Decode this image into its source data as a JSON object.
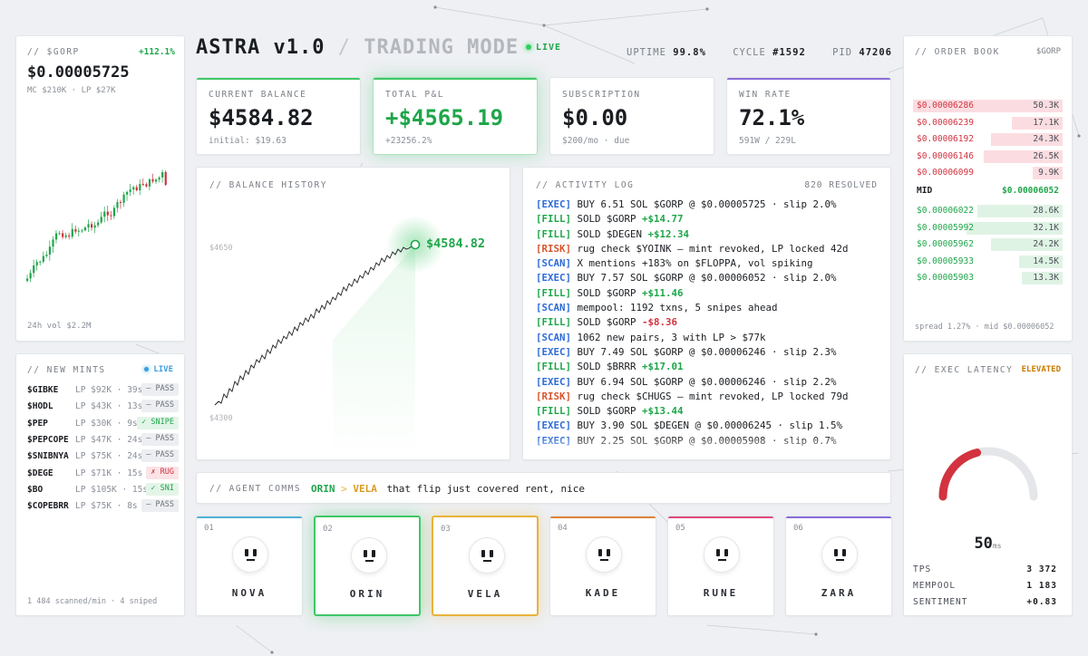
{
  "header": {
    "brand": "ASTRA v1.0",
    "separator": "/",
    "mode": "TRADING MODE",
    "live": "LIVE",
    "uptime_label": "UPTIME",
    "uptime": "99.8%",
    "cycle_label": "CYCLE",
    "cycle": "#1592",
    "pid_label": "PID",
    "pid": "47206"
  },
  "token": {
    "title": "// $GORP",
    "change": "+112.1%",
    "price": "$0.00005725",
    "mc_lp": "MC $210K · LP $27K",
    "vol": "24h vol $2.2M"
  },
  "metrics": [
    {
      "label": "CURRENT BALANCE",
      "value": "$4584.82",
      "sub": "initial: $19.63",
      "accent": "#3fc767"
    },
    {
      "label": "TOTAL P&L",
      "value": "+$4565.19",
      "sub": "+23256.2%",
      "accent": "#3fc767"
    },
    {
      "label": "SUBSCRIPTION",
      "value": "$0.00",
      "sub": "$200/mo · due",
      "accent": "#ffffff"
    },
    {
      "label": "WIN RATE",
      "value": "72.1%",
      "sub": "591W / 229L",
      "accent": "#8a6cd9"
    }
  ],
  "balance_history": {
    "title": "// BALANCE HISTORY",
    "y_high": "$4650",
    "y_low": "$4300",
    "current": "$4584.82"
  },
  "activity": {
    "title": "// ACTIVITY LOG",
    "resolved": "820 RESOLVED",
    "rows": [
      {
        "tag": "[EXEC]",
        "type": "EXEC",
        "text": " BUY 6.51 SOL $GORP @ $0.00005725 · slip 2.0%",
        "pnl": ""
      },
      {
        "tag": "[FILL]",
        "type": "FILL",
        "text": " SOLD $GORP ",
        "pnl": "+$14.77"
      },
      {
        "tag": "[FILL]",
        "type": "FILL",
        "text": " SOLD $DEGEN ",
        "pnl": "+$12.34"
      },
      {
        "tag": "[RISK]",
        "type": "RISK",
        "text": " rug check $YOINK — mint revoked, LP locked 42d",
        "pnl": ""
      },
      {
        "tag": "[SCAN]",
        "type": "SCAN",
        "text": " X mentions +183% on $FLOPPA, vol spiking",
        "pnl": ""
      },
      {
        "tag": "[EXEC]",
        "type": "EXEC",
        "text": " BUY 7.57 SOL $GORP @ $0.00006052 · slip 2.0%",
        "pnl": ""
      },
      {
        "tag": "[FILL]",
        "type": "FILL",
        "text": " SOLD $GORP ",
        "pnl": "+$11.46"
      },
      {
        "tag": "[SCAN]",
        "type": "SCAN",
        "text": " mempool: 1192 txns, 5 snipes ahead",
        "pnl": ""
      },
      {
        "tag": "[FILL]",
        "type": "FILL",
        "text": " SOLD $GORP ",
        "pnl": "-$8.36"
      },
      {
        "tag": "[SCAN]",
        "type": "SCAN",
        "text": " 1062 new pairs, 3 with LP > $77k",
        "pnl": ""
      },
      {
        "tag": "[EXEC]",
        "type": "EXEC",
        "text": " BUY 7.49 SOL $GORP @ $0.00006246 · slip 2.3%",
        "pnl": ""
      },
      {
        "tag": "[FILL]",
        "type": "FILL",
        "text": " SOLD $BRRR ",
        "pnl": "+$17.01"
      },
      {
        "tag": "[EXEC]",
        "type": "EXEC",
        "text": " BUY 6.94 SOL $GORP @ $0.00006246 · slip 2.2%",
        "pnl": ""
      },
      {
        "tag": "[RISK]",
        "type": "RISK",
        "text": " rug check $CHUGS — mint revoked, LP locked 79d",
        "pnl": ""
      },
      {
        "tag": "[FILL]",
        "type": "FILL",
        "text": " SOLD $GORP ",
        "pnl": "+$13.44"
      },
      {
        "tag": "[EXEC]",
        "type": "EXEC",
        "text": " BUY 3.90 SOL $DEGEN @ $0.00006245 · slip 1.5%",
        "pnl": ""
      },
      {
        "tag": "[EXEC]",
        "type": "EXEC",
        "text": " BUY 2.25 SOL $GORP @ $0.00005908 · slip 0.7%",
        "pnl": ""
      }
    ]
  },
  "order_book": {
    "title": "// ORDER BOOK",
    "symbol": "$GORP",
    "asks": [
      {
        "price": "$0.00006286",
        "size": "50.3K",
        "fill": 1.0
      },
      {
        "price": "$0.00006239",
        "size": "17.1K",
        "fill": 0.34
      },
      {
        "price": "$0.00006192",
        "size": "24.3K",
        "fill": 0.48
      },
      {
        "price": "$0.00006146",
        "size": "26.5K",
        "fill": 0.53
      },
      {
        "price": "$0.00006099",
        "size": "9.9K",
        "fill": 0.2
      }
    ],
    "mid_label": "MID",
    "mid": "$0.00006052",
    "bids": [
      {
        "price": "$0.00006022",
        "size": "28.6K",
        "fill": 0.57
      },
      {
        "price": "$0.00005992",
        "size": "32.1K",
        "fill": 0.64
      },
      {
        "price": "$0.00005962",
        "size": "24.2K",
        "fill": 0.48
      },
      {
        "price": "$0.00005933",
        "size": "14.5K",
        "fill": 0.29
      },
      {
        "price": "$0.00005903",
        "size": "13.3K",
        "fill": 0.27
      }
    ],
    "footer": "spread 1.27% · mid $0.00006052"
  },
  "mints": {
    "title": "// NEW MINTS",
    "live": "LIVE",
    "items": [
      {
        "symbol": "$GIBKE",
        "lp": "LP $92K · 39s",
        "badge": "— PASS",
        "kind": "pass"
      },
      {
        "symbol": "$HODL",
        "lp": "LP $43K · 13s",
        "badge": "— PASS",
        "kind": "pass"
      },
      {
        "symbol": "$PEP",
        "lp": "LP $30K · 9s",
        "badge": "✓ SNIPE",
        "kind": "snipe"
      },
      {
        "symbol": "$PEPCOPE",
        "lp": "LP $47K · 24s",
        "badge": "— PASS",
        "kind": "pass"
      },
      {
        "symbol": "$SNIBNYA",
        "lp": "LP $75K · 24s",
        "badge": "— PASS",
        "kind": "pass"
      },
      {
        "symbol": "$DEGE",
        "lp": "LP $71K · 15s",
        "badge": "✗ RUG",
        "kind": "rug"
      },
      {
        "symbol": "$BO",
        "lp": "LP $105K · 15s",
        "badge": "✓ SNI",
        "kind": "snipe"
      },
      {
        "symbol": "$COPEBRR",
        "lp": "LP $75K · 8s",
        "badge": "— PASS",
        "kind": "pass"
      }
    ],
    "footer": "1 484 scanned/min · 4 sniped"
  },
  "comms": {
    "title": "// AGENT COMMS",
    "from": "ORIN",
    "arrow": ">",
    "to": "VELA",
    "message": "that flip just covered rent, nice"
  },
  "agents": [
    {
      "num": "01",
      "name": "NOVA",
      "color": "#4fb3d9"
    },
    {
      "num": "02",
      "name": "ORIN",
      "color": "#3fc767"
    },
    {
      "num": "03",
      "name": "VELA",
      "color": "#e8b23a"
    },
    {
      "num": "04",
      "name": "KADE",
      "color": "#e0823a"
    },
    {
      "num": "05",
      "name": "RUNE",
      "color": "#e04a7c"
    },
    {
      "num": "06",
      "name": "ZARA",
      "color": "#8a6cd9"
    }
  ],
  "latency": {
    "title": "// EXEC LATENCY",
    "status": "ELEVATED",
    "value": "50",
    "unit": "ms",
    "gauge_fraction": 0.42,
    "tps_label": "TPS",
    "tps": "3 372",
    "mempool_label": "MEMPOOL",
    "mempool": "1 183",
    "sentiment_label": "SENTIMENT",
    "sentiment": "+0.83"
  }
}
